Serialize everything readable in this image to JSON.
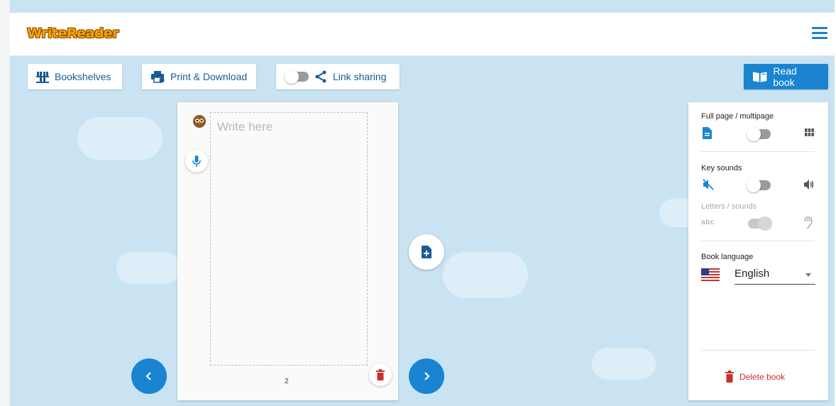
{
  "app": {
    "logo_text": "WriteReader"
  },
  "header": {
    "menu_icon": "hamburger-menu-icon"
  },
  "toolbar": {
    "bookshelves_label": "Bookshelves",
    "print_label": "Print & Download",
    "link_sharing_label": "Link sharing",
    "link_sharing_enabled": false,
    "read_book_label": "Read book"
  },
  "editor": {
    "placeholder": "Write here",
    "page_number": "2",
    "accent_color": "#1a84d1"
  },
  "panel": {
    "layout_label": "Full page / multipage",
    "layout_multipage": false,
    "key_sounds_label": "Key sounds",
    "key_sounds_enabled": false,
    "letters_sounds_label": "Letters / sounds",
    "letters_sounds_enabled": true,
    "letters_sounds_disabled": true,
    "abc_text": "abc",
    "book_language_label": "Book language",
    "language_value": "English",
    "delete_book_label": "Delete book",
    "danger_color": "#c8312a"
  }
}
